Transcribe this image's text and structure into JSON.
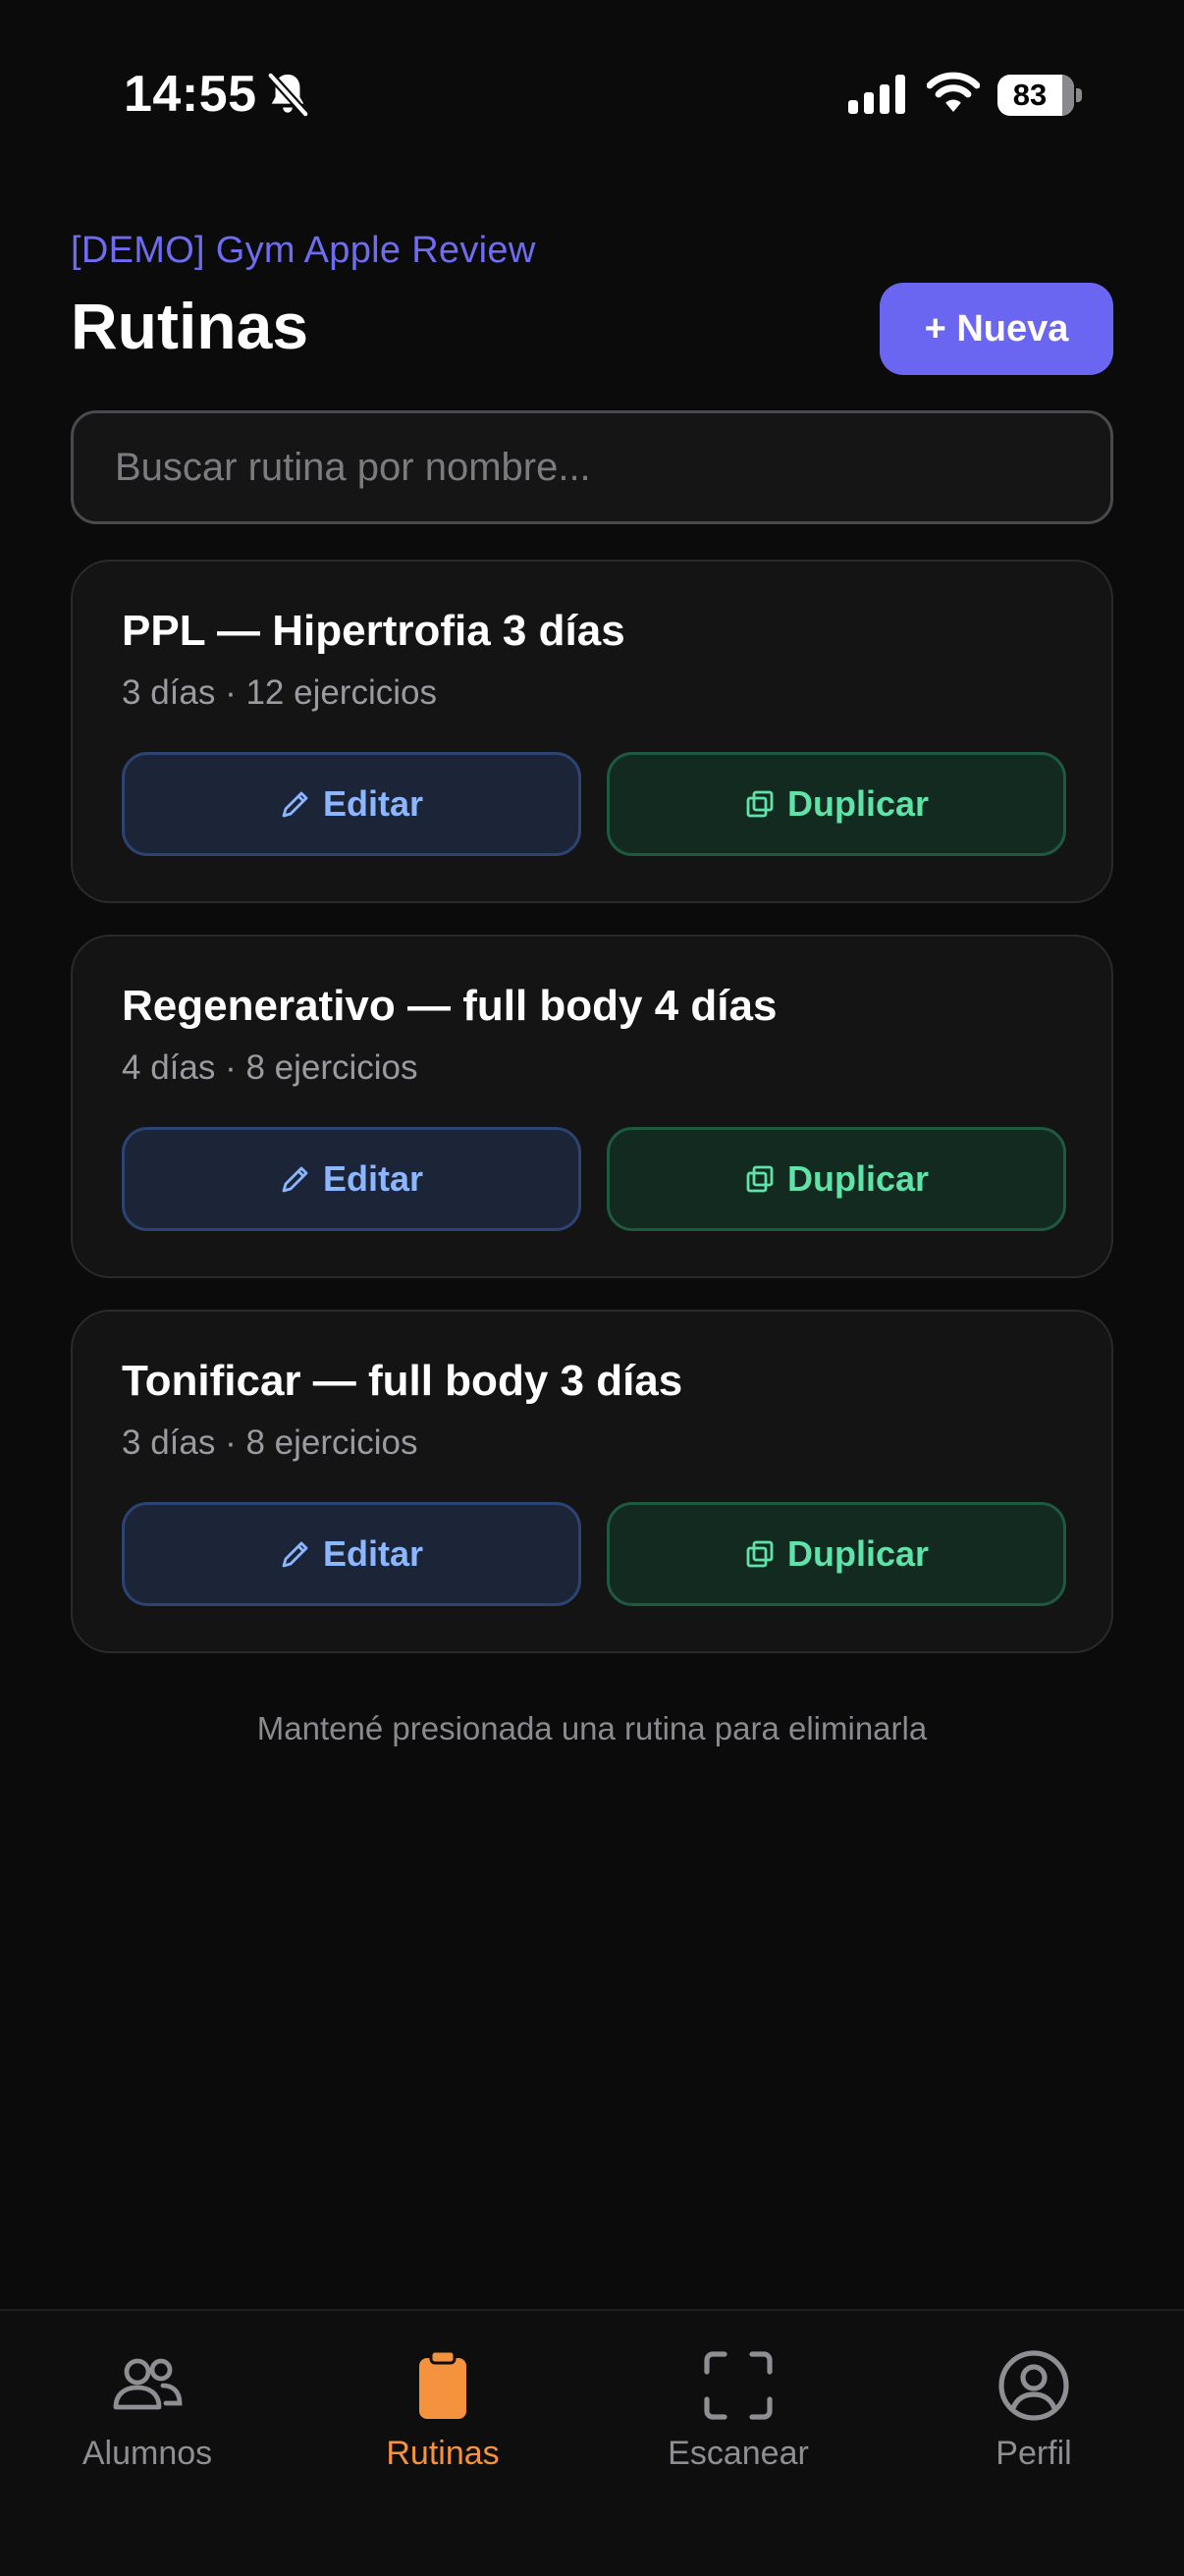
{
  "status_bar": {
    "time": "14:55",
    "battery_level": "83",
    "battery_fraction": 0.83,
    "icons": [
      "bell-muted-icon",
      "signal-icon",
      "wifi-icon",
      "battery-icon"
    ]
  },
  "header": {
    "gym_name": "[DEMO] Gym Apple Review",
    "title": "Rutinas",
    "new_button_label": "+ Nueva"
  },
  "search": {
    "value": "",
    "placeholder": "Buscar rutina por nombre..."
  },
  "routines": [
    {
      "title": "PPL — Hipertrofia 3 días",
      "meta": "3 días · 12 ejercicios",
      "edit_label": "Editar",
      "duplicate_label": "Duplicar"
    },
    {
      "title": "Regenerativo — full body 4 días",
      "meta": "4 días · 8 ejercicios",
      "edit_label": "Editar",
      "duplicate_label": "Duplicar"
    },
    {
      "title": "Tonificar — full body 3 días",
      "meta": "3 días · 8 ejercicios",
      "edit_label": "Editar",
      "duplicate_label": "Duplicar"
    }
  ],
  "hint": "Mantené presionada una rutina para eliminarla",
  "tab_bar": {
    "active_color": "#f5923e",
    "inactive_color": "#8e8e93",
    "items": [
      {
        "label": "Alumnos",
        "icon": "users-icon",
        "active": false
      },
      {
        "label": "Rutinas",
        "icon": "clipboard-icon",
        "active": true
      },
      {
        "label": "Escanear",
        "icon": "scan-icon",
        "active": false
      },
      {
        "label": "Perfil",
        "icon": "profile-icon",
        "active": false
      }
    ]
  },
  "colors": {
    "background": "#0b0b0c",
    "accent": "#6a66f2",
    "edit": "#8cb6ff",
    "duplicate": "#5fe3a8"
  }
}
